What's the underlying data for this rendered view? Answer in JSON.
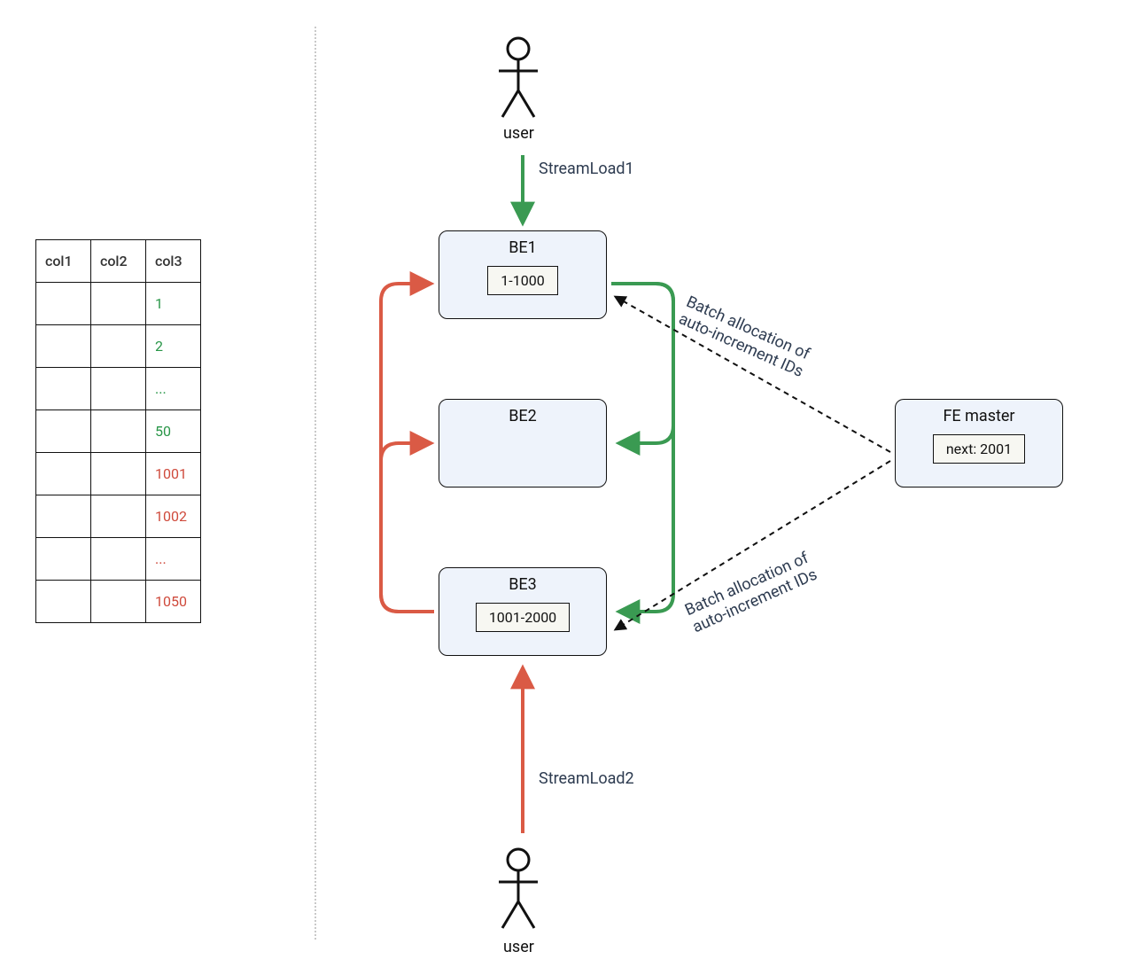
{
  "table": {
    "headers": [
      "col1",
      "col2",
      "col3"
    ],
    "rows": [
      {
        "col3": "1",
        "color": "green"
      },
      {
        "col3": "2",
        "color": "green"
      },
      {
        "col3": "...",
        "color": "green"
      },
      {
        "col3": "50",
        "color": "green"
      },
      {
        "col3": "1001",
        "color": "red"
      },
      {
        "col3": "1002",
        "color": "red"
      },
      {
        "col3": "...",
        "color": "red"
      },
      {
        "col3": "1050",
        "color": "red"
      }
    ]
  },
  "actors": {
    "top": {
      "label": "user"
    },
    "bottom": {
      "label": "user"
    }
  },
  "flows": {
    "top": "StreamLoad1",
    "bottom": "StreamLoad2"
  },
  "nodes": {
    "be1": {
      "title": "BE1",
      "range": "1-1000"
    },
    "be2": {
      "title": "BE2"
    },
    "be3": {
      "title": "BE3",
      "range": "1001-2000"
    },
    "fe": {
      "title": "FE master",
      "next": "next: 2001"
    }
  },
  "annotations": {
    "alloc1_line1": "Batch allocation of",
    "alloc1_line2": "auto-increment IDs",
    "alloc2_line1": "Batch allocation of",
    "alloc2_line2": "auto-increment IDs"
  },
  "colors": {
    "green": "#3a9a52",
    "red": "#da5a45"
  }
}
